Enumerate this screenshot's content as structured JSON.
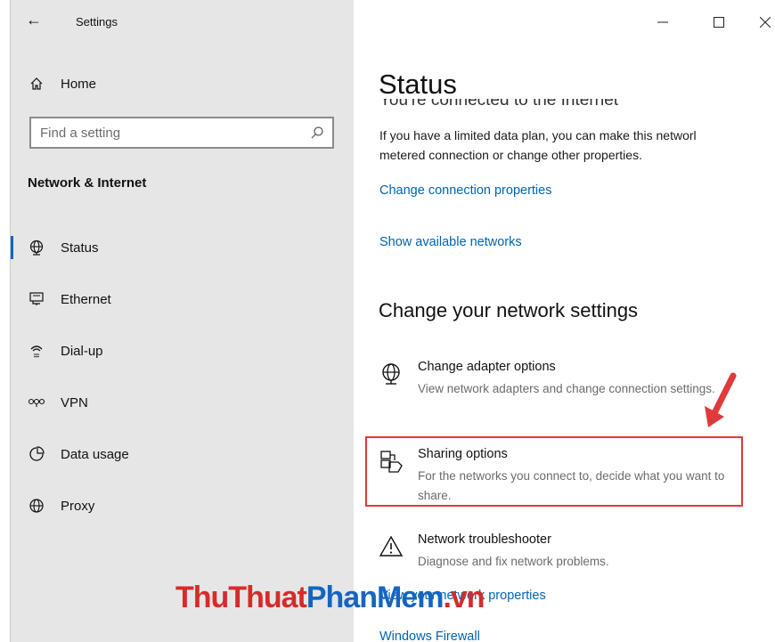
{
  "window": {
    "title": "Settings",
    "controls": {
      "minimize": "—",
      "maximize": "☐",
      "close": "✕"
    }
  },
  "sidebar": {
    "back_icon": "←",
    "home": {
      "label": "Home",
      "icon": "home-icon"
    },
    "search": {
      "placeholder": "Find a setting",
      "icon": "search-icon"
    },
    "section_header": "Network & Internet",
    "items": [
      {
        "label": "Status",
        "icon": "globe-status-icon",
        "selected": true
      },
      {
        "label": "Ethernet",
        "icon": "ethernet-icon",
        "selected": false
      },
      {
        "label": "Dial-up",
        "icon": "dialup-icon",
        "selected": false
      },
      {
        "label": "VPN",
        "icon": "vpn-icon",
        "selected": false
      },
      {
        "label": "Data usage",
        "icon": "data-usage-icon",
        "selected": false
      },
      {
        "label": "Proxy",
        "icon": "globe-icon",
        "selected": false
      }
    ],
    "accent_color": "#0067c0"
  },
  "main": {
    "title": "Status",
    "cut_heading": "You're connected to the Internet",
    "paragraph_line1": "If you have a limited data plan, you can make this networl",
    "paragraph_line2": "metered connection or change other properties.",
    "links": {
      "change_connection": "Change connection properties",
      "show_networks": "Show available networks"
    },
    "settings_heading": "Change your network settings",
    "options": [
      {
        "title": "Change adapter options",
        "desc": "View network adapters and change connection settings.",
        "icon": "adapter-globe-icon"
      },
      {
        "title": "Sharing options",
        "desc": "For the networks you connect to, decide what you want to share.",
        "icon": "sharing-icon"
      },
      {
        "title": "Network troubleshooter",
        "desc": "Diagnose and fix network problems.",
        "icon": "warning-icon"
      }
    ],
    "bottom_links": {
      "network_properties": "View your network properties",
      "firewall": "Windows Firewall"
    },
    "link_color": "#0063b1"
  },
  "annotation": {
    "highlight_color": "#e03a3a"
  },
  "watermark": {
    "part1": "ThuThuat",
    "part2": "PhanMem",
    "part3": ".vn"
  }
}
